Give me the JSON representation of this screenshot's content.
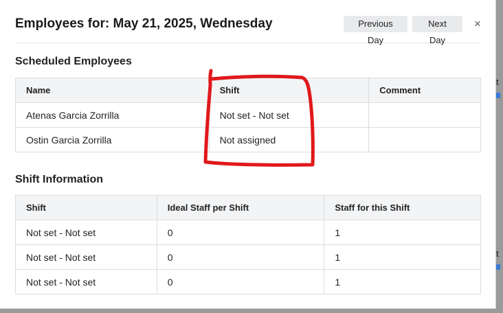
{
  "modal": {
    "title": "Employees for: May 21, 2025, Wednesday",
    "previous_day_label": "Previous Day",
    "next_day_label": "Next Day",
    "close_label": "×"
  },
  "scheduled": {
    "title": "Scheduled Employees",
    "headers": [
      "Name",
      "Shift",
      "Comment"
    ],
    "rows": [
      {
        "name": "Atenas Garcia Zorrilla",
        "shift": "Not set - Not set",
        "comment": ""
      },
      {
        "name": "Ostin Garcia Zorrilla",
        "shift": "Not assigned",
        "comment": ""
      }
    ]
  },
  "shift_info": {
    "title": "Shift Information",
    "headers": [
      "Shift",
      "Ideal Staff per Shift",
      "Staff for this Shift"
    ],
    "rows": [
      {
        "shift": "Not set - Not set",
        "ideal": "0",
        "staff": "1"
      },
      {
        "shift": "Not set - Not set",
        "ideal": "0",
        "staff": "1"
      },
      {
        "shift": "Not set - Not set",
        "ideal": "0",
        "staff": "1"
      }
    ]
  },
  "background": {
    "peek_text_1": "t",
    "peek_text_2": "t"
  },
  "colors": {
    "annotation": "#e0191b",
    "header_bg": "#f3f4f6",
    "button_bg": "#e9eaec"
  },
  "icons": {
    "close": "close-icon"
  }
}
